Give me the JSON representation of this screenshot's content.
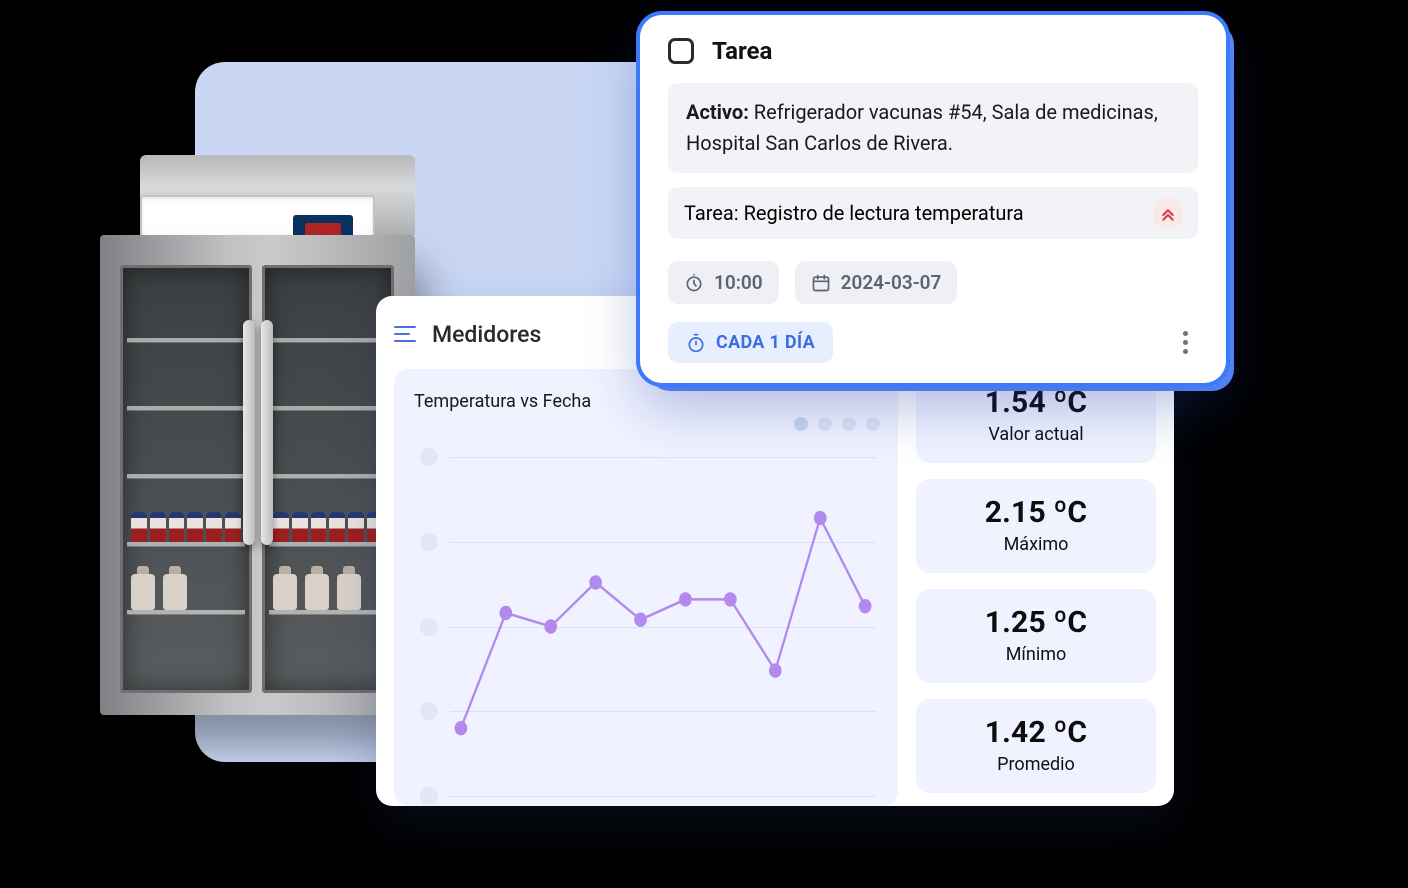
{
  "medidores": {
    "header_title": "Medidores",
    "stats": [
      {
        "value": "1.54 ºC",
        "label": "Valor actual"
      },
      {
        "value": "2.15 ºC",
        "label": "Máximo"
      },
      {
        "value": "1.25 ºC",
        "label": "Mínimo"
      },
      {
        "value": "1.42 ºC",
        "label": "Promedio"
      }
    ]
  },
  "tarea": {
    "head_title": "Tarea",
    "activo_label": "Activo:",
    "activo_text": "Refrigerador vacunas #54, Sala de medicinas, Hospital San Carlos de Rivera.",
    "tarea_label": "Tarea:",
    "tarea_text": "Registro de lectura temperatura",
    "time": "10:00",
    "date": "2024-03-07",
    "recurrence": "CADA 1 DÍA"
  },
  "chart_data": {
    "type": "line",
    "title": "Temperatura vs Fecha",
    "xlabel": "",
    "ylabel": "",
    "ylim": [
      0,
      100
    ],
    "x": [
      1,
      2,
      3,
      4,
      5,
      6,
      7,
      8,
      9,
      10
    ],
    "values": [
      20,
      54,
      50,
      63,
      52,
      58,
      58,
      37,
      82,
      56
    ],
    "series_color": "#b388ef",
    "yticks_count": 5,
    "pager_dots": 4
  }
}
